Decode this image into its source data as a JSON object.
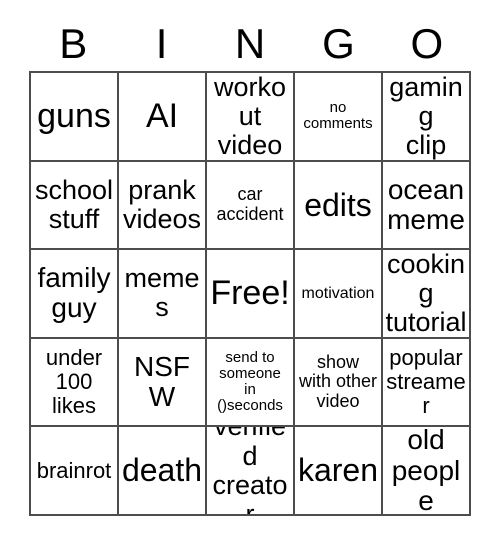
{
  "card": {
    "header_letters": [
      "B",
      "I",
      "N",
      "G",
      "O"
    ],
    "rows": [
      [
        {
          "text": "guns",
          "size": "xl"
        },
        {
          "text": "AI",
          "size": "xl"
        },
        {
          "text": "workout\nvideo",
          "size": "md"
        },
        {
          "text": "no\ncomments",
          "size": "tiny"
        },
        {
          "text": "gaming\nclip",
          "size": "md"
        }
      ],
      [
        {
          "text": "school\nstuff",
          "size": "md"
        },
        {
          "text": "prank\nvideos",
          "size": "md"
        },
        {
          "text": "car\naccident",
          "size": "xs"
        },
        {
          "text": "edits",
          "size": "lg"
        },
        {
          "text": "ocean\nmeme",
          "size": "ml"
        }
      ],
      [
        {
          "text": "family\nguy",
          "size": "ml"
        },
        {
          "text": "memes",
          "size": "md"
        },
        {
          "text": "Free!",
          "size": "xl"
        },
        {
          "text": "motivation",
          "size": "xxs"
        },
        {
          "text": "cooking\ntutorial",
          "size": "md"
        }
      ],
      [
        {
          "text": "under\n100\nlikes",
          "size": "sm"
        },
        {
          "text": "NSFW",
          "size": "ml"
        },
        {
          "text": "send to\nsomeone\nin\n()seconds",
          "size": "tiny"
        },
        {
          "text": "show\nwith other\nvideo",
          "size": "xs"
        },
        {
          "text": "popular\nstreamer",
          "size": "sm"
        }
      ],
      [
        {
          "text": "brainrot",
          "size": "sm"
        },
        {
          "text": "death",
          "size": "lg"
        },
        {
          "text": "verified\ncreator",
          "size": "md"
        },
        {
          "text": "karen",
          "size": "lg"
        },
        {
          "text": "old\npeople",
          "size": "ml"
        }
      ]
    ]
  },
  "colors": {
    "border": "#4d4d4d",
    "text": "#000000",
    "background": "#ffffff"
  }
}
